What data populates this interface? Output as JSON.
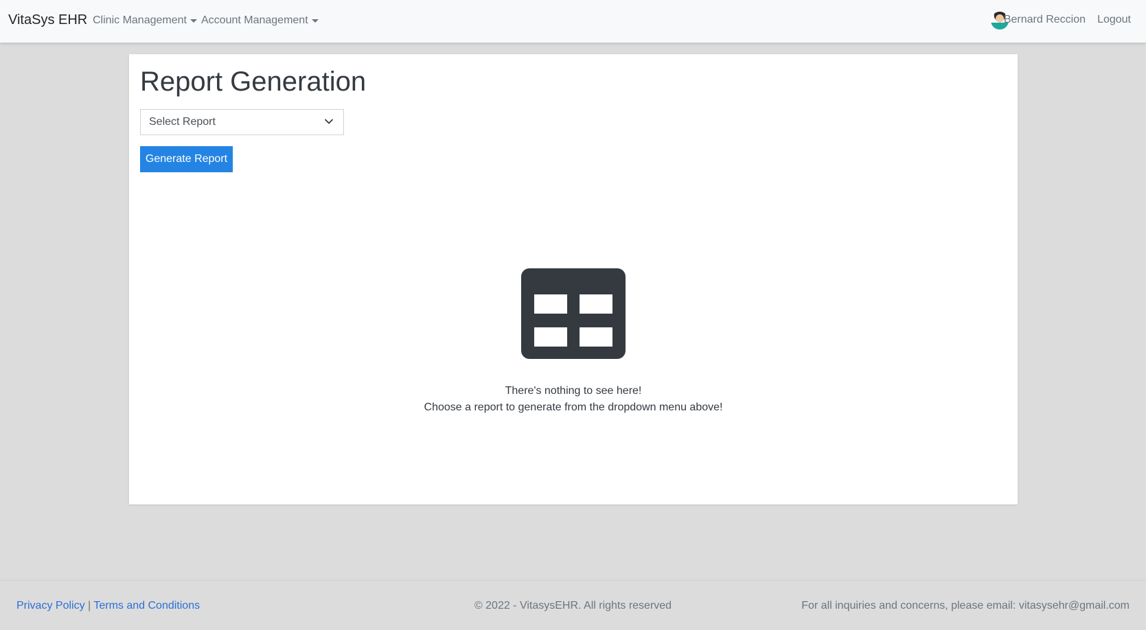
{
  "navbar": {
    "brand": "VitaSys EHR",
    "menus": [
      {
        "label": "Clinic Management"
      },
      {
        "label": "Account Management"
      }
    ],
    "user_name": "Bernard Reccion",
    "logout_label": "Logout"
  },
  "main": {
    "title": "Report Generation",
    "select": {
      "value": "Select Report"
    },
    "generate_label": "Generate Report",
    "empty_state": {
      "icon": "table-icon",
      "line1": "There's nothing to see here!",
      "line2": "Choose a report to generate from the dropdown menu above!"
    }
  },
  "footer": {
    "privacy_label": "Privacy Policy",
    "separator": "|",
    "terms_label": "Terms and Conditions",
    "copyright": "© 2022 - VitasysEHR. All rights reserved",
    "contact": "For all inquiries and concerns, please email: vitasysehr@gmail.com"
  },
  "colors": {
    "primary": "#2484e4",
    "background": "#dcdcdc",
    "navbar": "#f8f9fa",
    "link": "#2b6fd6"
  }
}
